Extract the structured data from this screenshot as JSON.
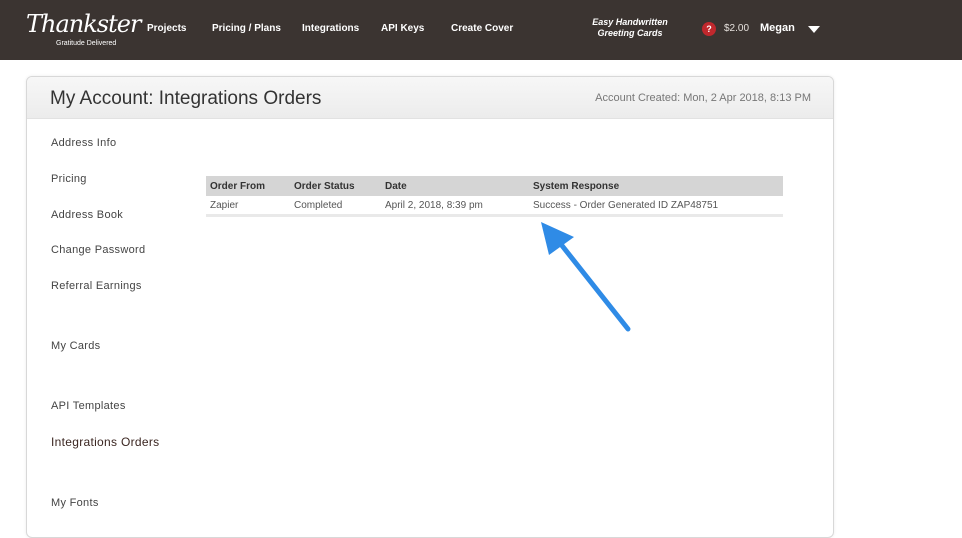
{
  "brand": {
    "logo_text": "Thankster",
    "tagline": "Gratitude Delivered"
  },
  "nav": {
    "items": [
      "Projects",
      "Pricing / Plans",
      "Integrations",
      "API Keys",
      "Create Cover"
    ],
    "promo_line1": "Easy Handwritten",
    "promo_line2": "Greeting Cards",
    "help_icon_text": "?",
    "balance": "$2.00",
    "user": "Megan"
  },
  "page": {
    "title": "My Account: Integrations Orders",
    "account_created": "Account Created: Mon, 2 Apr 2018, 8:13 PM"
  },
  "sidebar": {
    "items": [
      "Address Info",
      "Pricing",
      "Address Book",
      "Change Password",
      "Referral Earnings",
      "My Cards",
      "API Templates",
      "Integrations Orders",
      "My Fonts"
    ],
    "active": "Integrations Orders"
  },
  "orders": {
    "columns": [
      "Order From",
      "Order Status",
      "Date",
      "System Response"
    ],
    "rows": [
      [
        "Zapier",
        "Completed",
        "April 2, 2018, 8:39 pm",
        "Success - Order Generated ID ZAP48751"
      ]
    ]
  },
  "colors": {
    "topbar": "#3b3431",
    "arrow": "#2f8be6",
    "help_badge": "#c0282d"
  }
}
